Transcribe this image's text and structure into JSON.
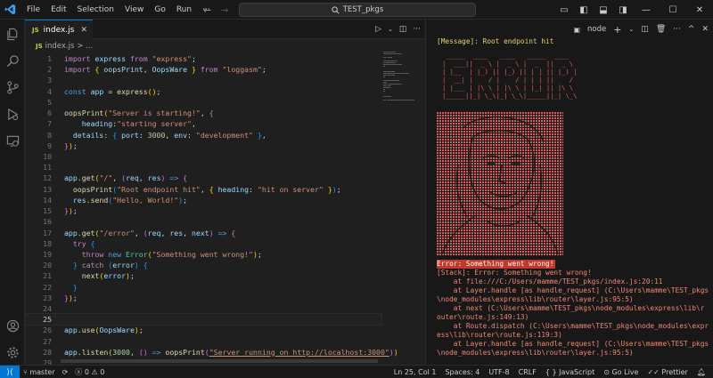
{
  "menu": [
    "File",
    "Edit",
    "Selection",
    "View",
    "Go",
    "Run",
    "···"
  ],
  "search": {
    "label": "TEST_pkgs"
  },
  "tab": {
    "name": "index.js",
    "badge": "JS"
  },
  "breadcrumb": {
    "badge": "JS",
    "file": "index.js",
    "more": "> ..."
  },
  "code": {
    "line_numbers": [
      "1",
      "2",
      "3",
      "4",
      "5",
      "6",
      "7",
      "8",
      "9",
      "10",
      "11",
      "12",
      "13",
      "14",
      "15",
      "16",
      "17",
      "18",
      "19",
      "20",
      "21",
      "22",
      "23",
      "24",
      "25",
      "26",
      "27",
      "28",
      "29"
    ],
    "current_line": 25,
    "lines": [
      [
        [
          "kw",
          "import "
        ],
        [
          "v",
          "express "
        ],
        [
          "kw",
          "from "
        ],
        [
          "s",
          "\"express\""
        ],
        [
          "p",
          ";"
        ]
      ],
      [
        [
          "kw",
          "import "
        ],
        [
          "b1",
          "{ "
        ],
        [
          "v",
          "oopsPrint"
        ],
        [
          "p",
          ", "
        ],
        [
          "v",
          "OopsWare "
        ],
        [
          "b1",
          "} "
        ],
        [
          "kw",
          "from "
        ],
        [
          "s",
          "\"loggasm\""
        ],
        [
          "p",
          ";"
        ]
      ],
      [],
      [
        [
          "kb",
          "const "
        ],
        [
          "v",
          "app "
        ],
        [
          "p",
          "= "
        ],
        [
          "fn",
          "express"
        ],
        [
          "b1",
          "()"
        ],
        [
          "p",
          ";"
        ]
      ],
      [],
      [
        [
          "fn",
          "oopsPrint"
        ],
        [
          "b1",
          "("
        ],
        [
          "s",
          "\"Server is starting!\""
        ],
        [
          "p",
          ", "
        ],
        [
          "b2",
          "{"
        ]
      ],
      [
        [
          "p",
          "    "
        ],
        [
          "v",
          "heading"
        ],
        [
          "p",
          ":"
        ],
        [
          "s",
          "\"starting server\""
        ],
        [
          "p",
          ","
        ]
      ],
      [
        [
          "p",
          "  "
        ],
        [
          "v",
          "details"
        ],
        [
          "p",
          ": "
        ],
        [
          "b3",
          "{ "
        ],
        [
          "v",
          "port"
        ],
        [
          "p",
          ": "
        ],
        [
          "n",
          "3000"
        ],
        [
          "p",
          ", "
        ],
        [
          "v",
          "env"
        ],
        [
          "p",
          ": "
        ],
        [
          "s",
          "\"development\" "
        ],
        [
          "b3",
          "}"
        ],
        [
          "p",
          ","
        ]
      ],
      [
        [
          "b2",
          "}"
        ],
        [
          "b1",
          ")"
        ],
        [
          "p",
          ";"
        ]
      ],
      [],
      [],
      [
        [
          "v",
          "app"
        ],
        [
          "p",
          "."
        ],
        [
          "fn",
          "get"
        ],
        [
          "b1",
          "("
        ],
        [
          "s",
          "\"/\""
        ],
        [
          "p",
          ", "
        ],
        [
          "b2",
          "("
        ],
        [
          "v",
          "req"
        ],
        [
          "p",
          ", "
        ],
        [
          "v",
          "res"
        ],
        [
          "b2",
          ")"
        ],
        [
          "p",
          " "
        ],
        [
          "kb",
          "=>"
        ],
        [
          "p",
          " "
        ],
        [
          "b2",
          "{"
        ]
      ],
      [
        [
          "p",
          "  "
        ],
        [
          "fn",
          "oopsPrint"
        ],
        [
          "b3",
          "("
        ],
        [
          "s",
          "\"Root endpoint hit\""
        ],
        [
          "p",
          ", "
        ],
        [
          "b1",
          "{ "
        ],
        [
          "v",
          "heading"
        ],
        [
          "p",
          ": "
        ],
        [
          "s",
          "\"hit on server\" "
        ],
        [
          "b1",
          "}"
        ],
        [
          "b3",
          ")"
        ],
        [
          "p",
          ";"
        ]
      ],
      [
        [
          "p",
          "  "
        ],
        [
          "v",
          "res"
        ],
        [
          "p",
          "."
        ],
        [
          "fn",
          "send"
        ],
        [
          "b3",
          "("
        ],
        [
          "s",
          "\"Hello, World!\""
        ],
        [
          "b3",
          ")"
        ],
        [
          "p",
          ";"
        ]
      ],
      [
        [
          "b2",
          "}"
        ],
        [
          "b1",
          ")"
        ],
        [
          "p",
          ";"
        ]
      ],
      [],
      [
        [
          "v",
          "app"
        ],
        [
          "p",
          "."
        ],
        [
          "fn",
          "get"
        ],
        [
          "b1",
          "("
        ],
        [
          "s",
          "\"/error\""
        ],
        [
          "p",
          ", "
        ],
        [
          "b2",
          "("
        ],
        [
          "v",
          "req"
        ],
        [
          "p",
          ", "
        ],
        [
          "v",
          "res"
        ],
        [
          "p",
          ", "
        ],
        [
          "v",
          "next"
        ],
        [
          "b2",
          ")"
        ],
        [
          "p",
          " "
        ],
        [
          "kb",
          "=>"
        ],
        [
          "p",
          " "
        ],
        [
          "b2",
          "{"
        ]
      ],
      [
        [
          "p",
          "  "
        ],
        [
          "kw",
          "try "
        ],
        [
          "b3",
          "{"
        ]
      ],
      [
        [
          "p",
          "    "
        ],
        [
          "kw",
          "throw "
        ],
        [
          "kb",
          "new "
        ],
        [
          "c",
          "Error"
        ],
        [
          "b1",
          "("
        ],
        [
          "s",
          "\"Something went wrong!\""
        ],
        [
          "b1",
          ")"
        ],
        [
          "p",
          ";"
        ]
      ],
      [
        [
          "p",
          "  "
        ],
        [
          "b3",
          "} "
        ],
        [
          "kw",
          "catch "
        ],
        [
          "b3",
          "("
        ],
        [
          "v",
          "error"
        ],
        [
          "b3",
          ") {"
        ]
      ],
      [
        [
          "p",
          "    "
        ],
        [
          "fn",
          "next"
        ],
        [
          "b1",
          "("
        ],
        [
          "v",
          "error"
        ],
        [
          "b1",
          ")"
        ],
        [
          "p",
          ";"
        ]
      ],
      [
        [
          "p",
          "  "
        ],
        [
          "b3",
          "}"
        ]
      ],
      [
        [
          "b2",
          "}"
        ],
        [
          "b1",
          ")"
        ],
        [
          "p",
          ";"
        ]
      ],
      [],
      [],
      [
        [
          "v",
          "app"
        ],
        [
          "p",
          "."
        ],
        [
          "fn",
          "use"
        ],
        [
          "b1",
          "("
        ],
        [
          "v",
          "OopsWare"
        ],
        [
          "b1",
          ")"
        ],
        [
          "p",
          ";"
        ]
      ],
      [],
      [
        [
          "v",
          "app"
        ],
        [
          "p",
          "."
        ],
        [
          "fn",
          "listen"
        ],
        [
          "b1",
          "("
        ],
        [
          "n",
          "3000"
        ],
        [
          "p",
          ", "
        ],
        [
          "b2",
          "()"
        ],
        [
          "p",
          " "
        ],
        [
          "kb",
          "=>"
        ],
        [
          "p",
          " "
        ],
        [
          "fn",
          "oopsPrint"
        ],
        [
          "b2",
          "("
        ],
        [
          "url",
          "\"Server running on http://localhost:3000\""
        ],
        [
          "b2",
          ")"
        ],
        [
          "b1",
          ")"
        ]
      ],
      []
    ]
  },
  "terminal": {
    "shell": "node",
    "message": "[Message]: Root endpoint hit",
    "banner": [
      " _____  ____   ____   _____  ____  ",
      "|  ___||  _ \\ |  _ \\ |  _  ||  _ \\ ",
      "| |__  | |_) || |_) || | | || |_) |",
      "|  __| |    / |    / | | | ||    / ",
      "| |___ | |\\ \\ | |\\ \\ | |_| || |\\ \\ ",
      "|_____||_| \\_\\|_| \\_\\|_____||_| \\_\\"
    ],
    "error_line": "Error: Something went wrong!",
    "stack": [
      "[Stack]: Error: Something went wrong!",
      "    at file:///C:/Users/mamme/TEST_pkgs/index.js:20:11",
      "    at Layer.handle [as handle_request] (C:\\Users\\mamme\\TEST_pkgs",
      "\\node_modules\\express\\lib\\router\\layer.js:95:5)",
      "    at next (C:\\Users\\mamme\\TEST_pkgs\\node_modules\\express\\lib\\r",
      "outer\\route.js:149:13)",
      "    at Route.dispatch (C:\\Users\\mamme\\TEST_pkgs\\node_modules\\expr",
      "ess\\lib\\router\\route.js:119:3)",
      "    at Layer.handle [as handle_request] (C:\\Users\\mamme\\TEST_pkgs",
      "\\node_modules\\express\\lib\\router\\layer.js:95:5)"
    ]
  },
  "status": {
    "branch": "master",
    "errors": "0",
    "warnings": "0",
    "position": "Ln 25, Col 1",
    "spaces": "Spaces: 4",
    "encoding": "UTF-8",
    "eol": "CRLF",
    "language": "JavaScript",
    "golive": "Go Live",
    "prettier": "Prettier"
  },
  "colors": {
    "accent": "#0078d4",
    "error_bg": "#c0392b",
    "terminal_text": "#f48771",
    "message": "#e9d36d"
  }
}
